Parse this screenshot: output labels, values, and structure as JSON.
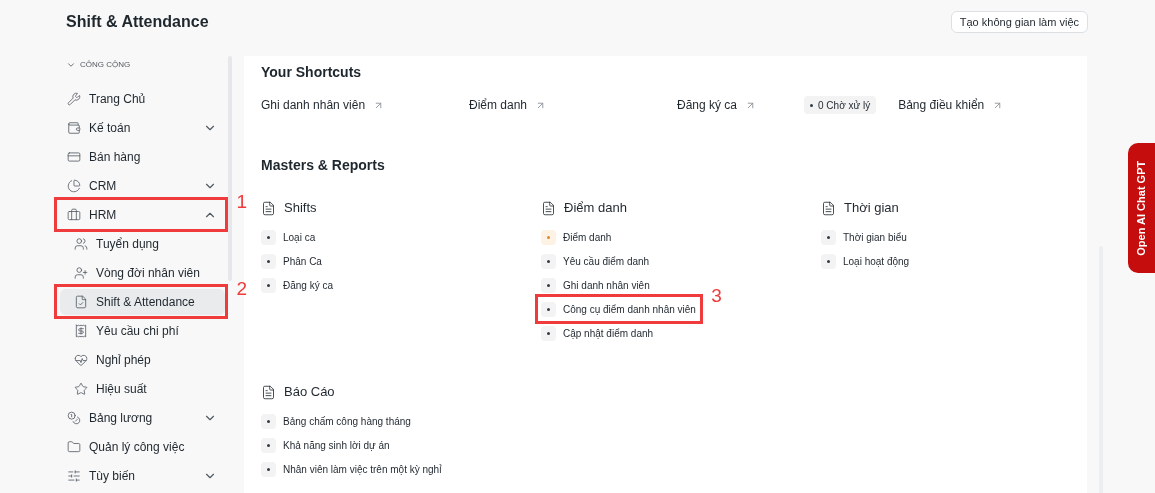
{
  "page": {
    "title": "Shift & Attendance",
    "action_button": "Tạo không gian làm việc"
  },
  "sidebar": {
    "section": "CÔNG CỘNG",
    "section_expanded": true,
    "items": [
      {
        "label": "Trang Chủ",
        "selected": false
      },
      {
        "label": "Kế toán",
        "expanded": false,
        "selected": false
      },
      {
        "label": "Bán hàng",
        "selected": false
      },
      {
        "label": "CRM",
        "expanded": false,
        "selected": false
      },
      {
        "label": "HRM",
        "expanded": true,
        "selected": false,
        "annotation": "1",
        "children": [
          {
            "label": "Tuyển dụng",
            "selected": false
          },
          {
            "label": "Vòng đời nhân viên",
            "selected": false
          },
          {
            "label": "Shift & Attendance",
            "selected": true,
            "annotation": "2"
          },
          {
            "label": "Yêu cầu chi phí",
            "selected": false
          },
          {
            "label": "Nghỉ phép",
            "selected": false
          },
          {
            "label": "Hiệu suất",
            "selected": false
          }
        ]
      },
      {
        "label": "Bảng lương",
        "expanded": false,
        "selected": false
      },
      {
        "label": "Quản lý công việc",
        "selected": false
      },
      {
        "label": "Tùy biến",
        "expanded": false,
        "selected": false
      }
    ]
  },
  "shortcuts": {
    "title": "Your Shortcuts",
    "items": [
      {
        "label": "Ghi danh nhân viên"
      },
      {
        "label": "Điểm danh"
      },
      {
        "label": "Đăng ký ca",
        "badge": "0 Chờ xử lý"
      },
      {
        "label": "Bảng điều khiển"
      }
    ]
  },
  "masters": {
    "title": "Masters & Reports",
    "cards": [
      {
        "title": "Shifts",
        "items": [
          {
            "label": "Loại ca",
            "highlighted": false
          },
          {
            "label": "Phân Ca",
            "highlighted": false
          },
          {
            "label": "Đăng ký ca",
            "highlighted": false
          }
        ]
      },
      {
        "title": "Điểm danh",
        "items": [
          {
            "label": "Điểm danh",
            "highlighted": true
          },
          {
            "label": "Yêu cầu điểm danh",
            "highlighted": false
          },
          {
            "label": "Ghi danh nhân viên",
            "highlighted": false
          },
          {
            "label": "Công cụ điểm danh nhân viên",
            "highlighted": false,
            "annotation": "3"
          },
          {
            "label": "Cập nhật điểm danh",
            "highlighted": false
          }
        ]
      },
      {
        "title": "Thời gian",
        "items": [
          {
            "label": "Thời gian biểu",
            "highlighted": false
          },
          {
            "label": "Loại hoạt động",
            "highlighted": false
          }
        ]
      },
      {
        "title": "Báo Cáo",
        "items": [
          {
            "label": "Bảng chấm công hàng tháng",
            "highlighted": false
          },
          {
            "label": "Khả năng sinh lời dự án",
            "highlighted": false
          },
          {
            "label": "Nhân viên làm việc trên một kỳ nghỉ",
            "highlighted": false
          }
        ]
      }
    ]
  },
  "side_tab": {
    "label": "Open AI Chat GPT"
  }
}
